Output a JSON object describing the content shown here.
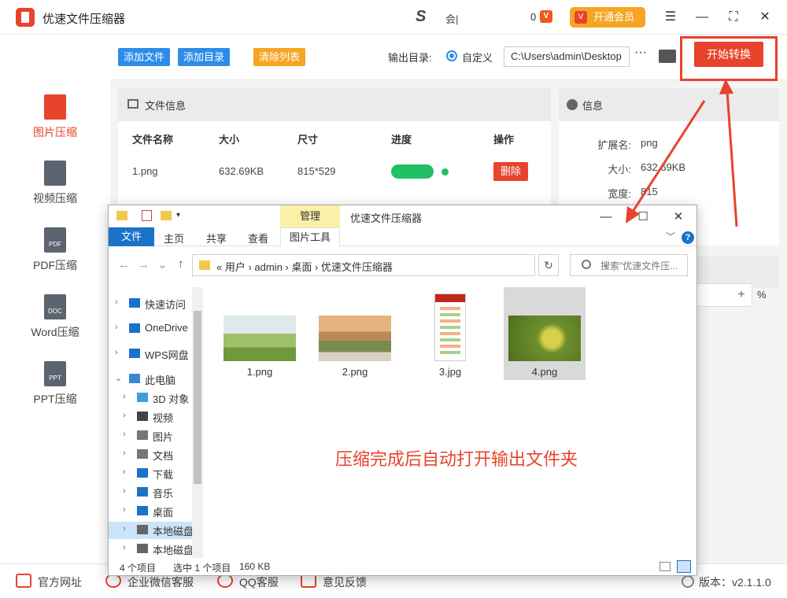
{
  "app": {
    "title": "优速文件压缩器",
    "user_text": "会|",
    "coin_count": "0",
    "coin_icon": "V",
    "vip_label": "开通会员",
    "vip_icon": "V",
    "brand_letter": "S"
  },
  "window_controls": {
    "menu": "☰",
    "minimize": "—",
    "maximize": "⛶",
    "close": "✕"
  },
  "sidebar": {
    "items": [
      {
        "label": "图片压缩",
        "icon": "image-compress-icon",
        "tag": "",
        "active": true
      },
      {
        "label": "视频压缩",
        "icon": "video-compress-icon",
        "tag": "",
        "active": false
      },
      {
        "label": "PDF压缩",
        "icon": "pdf-compress-icon",
        "tag": "PDF",
        "active": false
      },
      {
        "label": "Word压缩",
        "icon": "word-compress-icon",
        "tag": "DOC",
        "active": false
      },
      {
        "label": "PPT压缩",
        "icon": "ppt-compress-icon",
        "tag": "PPT",
        "active": false
      }
    ]
  },
  "toolbar": {
    "add_file": "添加文件",
    "add_dir": "添加目录",
    "clear_list": "清除列表",
    "output_label": "输出目录:",
    "custom_label": "自定义",
    "path": "C:\\Users\\admin\\Desktop",
    "more": "···",
    "start_label": "开始转换"
  },
  "file_panel": {
    "title": "文件信息",
    "headers": [
      "文件名称",
      "大小",
      "尺寸",
      "进度",
      "操作"
    ],
    "row": {
      "name": "1.png",
      "size": "632.69KB",
      "dims": "815*529",
      "progress": 1.0,
      "delete": "删除"
    }
  },
  "info_panel": {
    "title": "信息",
    "fields": [
      {
        "k": "扩展名:",
        "v": "png"
      },
      {
        "k": "大小:",
        "v": "632.69KB"
      },
      {
        "k": "宽度:",
        "v": "815"
      }
    ]
  },
  "stepper": {
    "plus": "+",
    "unit": "%"
  },
  "footer": {
    "links": [
      "官方网址",
      "企业微信客服",
      "QQ客服",
      "意见反馈"
    ],
    "version": "版本：v2.1.1.0"
  },
  "explorer": {
    "manage_tab": "管理",
    "window_title": "优速文件压缩器",
    "ribbon": [
      "文件",
      "主页",
      "共享",
      "查看"
    ],
    "ribbon_tool": "图片工具",
    "help": "?",
    "path": "«  用户  ›  admin  ›  桌面  ›  优速文件压缩器",
    "search_placeholder": "搜索\"优速文件压...",
    "nav": [
      {
        "label": "快速访问",
        "indent": 0,
        "icon": "star-icon",
        "color": "#1a73c8"
      },
      {
        "label": "OneDrive",
        "indent": 0,
        "icon": "cloud-icon",
        "color": "#1a73c8"
      },
      {
        "label": "WPS网盘",
        "indent": 0,
        "icon": "cloud-icon",
        "color": "#1a73c8"
      },
      {
        "label": "此电脑",
        "indent": 0,
        "icon": "computer-icon",
        "color": "#3a86d8"
      },
      {
        "label": "3D 对象",
        "indent": 1,
        "icon": "cube-icon",
        "color": "#3aa0e0"
      },
      {
        "label": "视频",
        "indent": 1,
        "icon": "film-icon",
        "color": "#444"
      },
      {
        "label": "图片",
        "indent": 1,
        "icon": "picture-icon",
        "color": "#777"
      },
      {
        "label": "文档",
        "indent": 1,
        "icon": "document-icon",
        "color": "#777"
      },
      {
        "label": "下载",
        "indent": 1,
        "icon": "download-icon",
        "color": "#1a73c8"
      },
      {
        "label": "音乐",
        "indent": 1,
        "icon": "music-icon",
        "color": "#1a73c8"
      },
      {
        "label": "桌面",
        "indent": 1,
        "icon": "desktop-icon",
        "color": "#1a73c8"
      },
      {
        "label": "本地磁盘",
        "indent": 1,
        "icon": "drive-icon",
        "color": "#666"
      },
      {
        "label": "本地磁盘",
        "indent": 1,
        "icon": "drive-icon",
        "color": "#666"
      }
    ],
    "files": [
      {
        "name": "1.png",
        "kind": "landscape-green"
      },
      {
        "name": "2.png",
        "kind": "landscape-sunset"
      },
      {
        "name": "3.jpg",
        "kind": "document"
      },
      {
        "name": "4.png",
        "kind": "flower",
        "selected": true
      }
    ],
    "status": {
      "count": "4 个项目",
      "selected": "选中 1 个项目",
      "size": "160 KB"
    }
  },
  "overlay_message": "压缩完成后自动打开输出文件夹",
  "colors": {
    "accent": "#e8432c",
    "blue": "#2d8ce8",
    "orange": "#f5a623",
    "green": "#21c063"
  }
}
